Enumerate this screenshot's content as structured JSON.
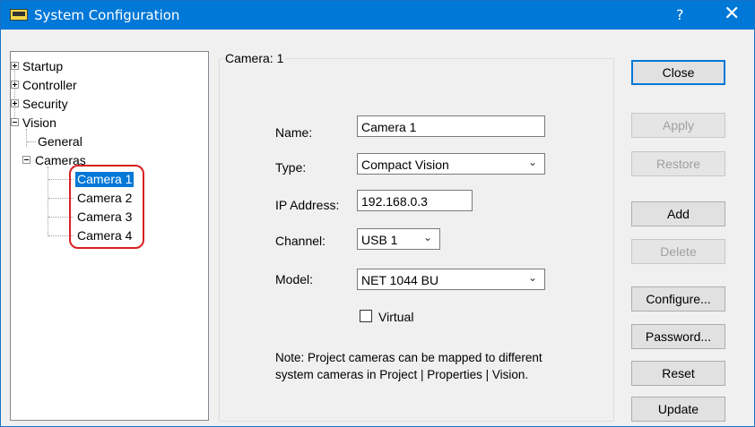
{
  "window": {
    "title": "System Configuration",
    "help_glyph": "?",
    "close_glyph": "✕",
    "accent_color": "#0078d7"
  },
  "tree": {
    "startup": "Startup",
    "controller": "Controller",
    "security": "Security",
    "vision": "Vision",
    "general": "General",
    "cameras": "Cameras",
    "camera_items": [
      "Camera 1",
      "Camera 2",
      "Camera 3",
      "Camera 4"
    ],
    "selected": "Camera 1"
  },
  "panel": {
    "group_title": "Camera: 1",
    "name_label": "Name:",
    "name_value": "Camera 1",
    "type_label": "Type:",
    "type_value": "Compact Vision",
    "ip_label": "IP Address:",
    "ip_value": "192.168.0.3",
    "channel_label": "Channel:",
    "channel_value": "USB 1",
    "model_label": "Model:",
    "model_value": "NET 1044 BU",
    "virtual_label": "Virtual",
    "virtual_checked": false,
    "note_line1": "Note: Project cameras can be mapped to different",
    "note_line2": "system cameras in Project | Properties | Vision."
  },
  "buttons": {
    "close": "Close",
    "apply": "Apply",
    "restore": "Restore",
    "add": "Add",
    "delete": "Delete",
    "configure": "Configure...",
    "password": "Password...",
    "reset": "Reset",
    "update": "Update"
  }
}
